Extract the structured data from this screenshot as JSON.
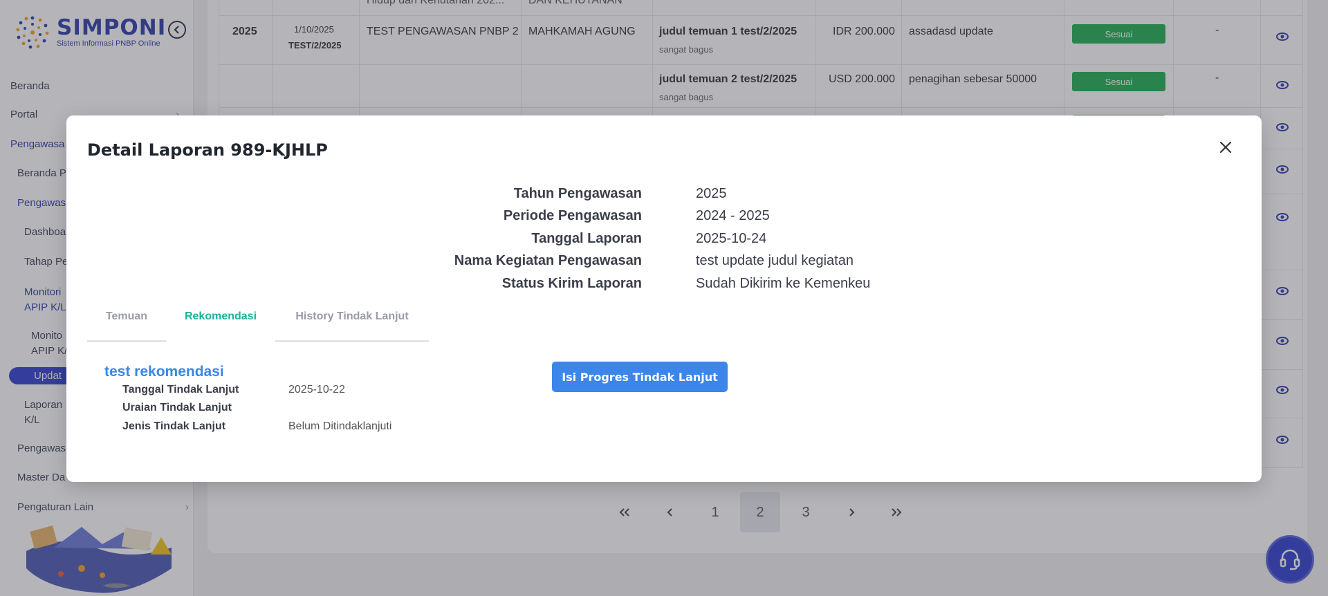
{
  "app": {
    "logo_title": "SIMPONI",
    "logo_subtitle": "Sistem Informasi PNBP Online"
  },
  "sidebar": {
    "items": [
      {
        "label": "Beranda"
      },
      {
        "label": "Portal"
      },
      {
        "label": "Pengawasa"
      },
      {
        "label": "Beranda P"
      },
      {
        "label": "Pengawas"
      },
      {
        "label": "Dashboa"
      },
      {
        "label": "Tahap Pe"
      },
      {
        "label": "Monitori"
      },
      {
        "label": "APIP K/L"
      },
      {
        "label": "Monito"
      },
      {
        "label": "APIP K/"
      },
      {
        "label": "Updat"
      },
      {
        "label": "Laporan"
      },
      {
        "label": "K/L"
      },
      {
        "label": "Pengawas"
      },
      {
        "label": "Master Da"
      },
      {
        "label": "Pengaturan Lain"
      }
    ]
  },
  "table": {
    "partial_top": {
      "text1": "Hidup dan Kehutanan 202...",
      "text2": "DAN KEHUTANAN"
    },
    "row1": {
      "year": "2025",
      "date": "1/10/2025",
      "code": "TEST/2/2025",
      "activity": "TEST PENGAWASAN PNBP 2",
      "agency": "MAHKAMAH AGUNG",
      "finding_title": "judul temuan 1 test/2/2025",
      "finding_note": "sangat bagus",
      "amount": "IDR 200.000",
      "remark": "assadasd update",
      "status": "Sesuai",
      "extra": "-"
    },
    "row2": {
      "finding_title": "judul temuan 2 test/2/2025",
      "finding_note": "sangat bagus",
      "amount": "USD 200.000",
      "remark": "penagihan sebesar 50000",
      "status": "Sesuai",
      "extra": "-"
    }
  },
  "pagination": {
    "pages": [
      "1",
      "2",
      "3"
    ],
    "current": "2"
  },
  "modal": {
    "title": "Detail Laporan 989-KJHLP",
    "meta": [
      {
        "label": "Tahun Pengawasan",
        "value": "2025"
      },
      {
        "label": "Periode Pengawasan",
        "value": "2024 - 2025"
      },
      {
        "label": "Tanggal Laporan",
        "value": "2025-10-24"
      },
      {
        "label": "Nama Kegiatan Pengawasan",
        "value": "test update judul kegiatan"
      },
      {
        "label": "Status Kirim Laporan",
        "value": "Sudah Dikirim ke Kemenkeu"
      }
    ],
    "colon": ":",
    "tabs": [
      "Temuan",
      "Rekomendasi",
      "History Tindak Lanjut"
    ],
    "active_tab": "Rekomendasi",
    "recommendation": {
      "title": "test rekomendasi",
      "rows": [
        {
          "label": "Tanggal Tindak Lanjut",
          "value": "2025-10-22"
        },
        {
          "label": "Uraian Tindak Lanjut",
          "value": ""
        },
        {
          "label": "Jenis Tindak Lanjut",
          "value": "Belum Ditindaklanjuti"
        }
      ]
    },
    "action_button": "Isi Progres Tindak Lanjut"
  },
  "icons": {
    "close": "close-icon",
    "eye": "eye-icon",
    "help": "headset-icon",
    "collapse": "chevron-left-icon"
  },
  "colors": {
    "brand": "#2d3aa8",
    "accent_tab": "#17b39a",
    "primary_button": "#3c86ea",
    "status_badge": "#1fae4f",
    "active_nav": "#2f3ecf"
  }
}
